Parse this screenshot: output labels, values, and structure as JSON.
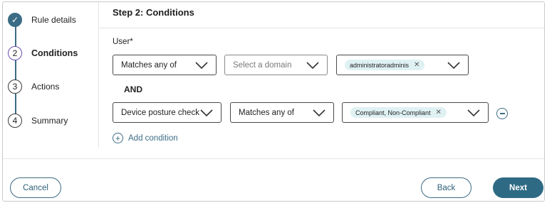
{
  "stepper": {
    "steps": [
      {
        "number": "✓",
        "label": "Rule details",
        "state": "done"
      },
      {
        "number": "2",
        "label": "Conditions",
        "state": "active"
      },
      {
        "number": "3",
        "label": "Actions",
        "state": "pending"
      },
      {
        "number": "4",
        "label": "Summary",
        "state": "pending"
      }
    ]
  },
  "main": {
    "title": "Step 2: Conditions",
    "user_label": "User*",
    "row1": {
      "operator": "Matches any of",
      "domain_placeholder": "Select a domain",
      "value_chip": "administratoradminis"
    },
    "and_label": "AND",
    "row2": {
      "type": "Device posture check",
      "operator": "Matches any of",
      "value_chip": "Compliant, Non-Compliant"
    },
    "add_condition_label": "Add condition"
  },
  "footer": {
    "cancel_label": "Cancel",
    "back_label": "Back",
    "next_label": "Next"
  },
  "colors": {
    "accent": "#3c6c85",
    "primary_button": "#2f6a84",
    "active_step_ring": "#6a4fb3",
    "chip_bg": "#dff1f3"
  }
}
